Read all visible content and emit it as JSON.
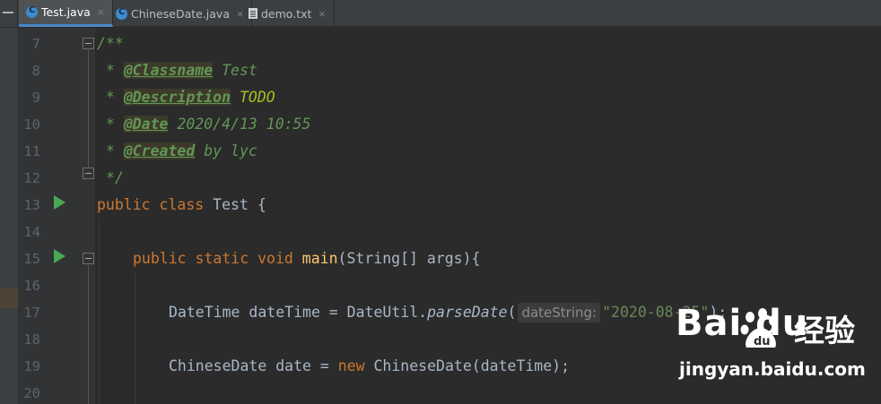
{
  "tabs": [
    {
      "label": "Test.java",
      "icon": "java-class-icon",
      "active": true
    },
    {
      "label": "ChineseDate.java",
      "icon": "java-class-icon",
      "active": false
    },
    {
      "label": "demo.txt",
      "icon": "text-file-icon",
      "active": false
    }
  ],
  "tab_close_glyph": "×",
  "line_numbers": [
    "7",
    "8",
    "9",
    "10",
    "11",
    "12",
    "13",
    "14",
    "15",
    "16",
    "17",
    "18",
    "19",
    "20"
  ],
  "code": {
    "l7": "/**",
    "l8_star": " * ",
    "l8_tag": "@Classname",
    "l8_rest": " Test",
    "l9_star": " * ",
    "l9_tag": "@Description",
    "l9_rest": " TODO",
    "l10_star": " * ",
    "l10_tag": "@Date",
    "l10_rest": " 2020/4/13 10:55",
    "l11_star": " * ",
    "l11_tag": "@Created",
    "l11_rest": " by lyc",
    "l12": " */",
    "l13_kw1": "public",
    "l13_kw2": "class",
    "l13_rest": " Test {",
    "l15_kw1": "public",
    "l15_kw2": "static",
    "l15_kw3": "void",
    "l15_fn": "main",
    "l15_rest": "(String[] args){",
    "l17_a": "DateTime dateTime = DateUtil.",
    "l17_call": "parseDate",
    "l17_paren": "(",
    "l17_hint": "dateString:",
    "l17_str": "\"2020-08-25\"",
    "l17_end": ");",
    "l19_a": "ChineseDate date = ",
    "l19_kw": "new",
    "l19_b": " ChineseDate(dateTime);"
  },
  "watermark": {
    "logo": "Bai  du",
    "brand_cn": "经验",
    "url": "jingyan.baidu.com"
  },
  "colors": {
    "editor_bg": "#2b2b2b",
    "keyword": "#cc7832",
    "doc_comment": "#629755",
    "string": "#6a8759",
    "method_decl": "#ffc66d",
    "run_icon": "#4aa854",
    "active_tab_underline": "#4a88c7"
  }
}
